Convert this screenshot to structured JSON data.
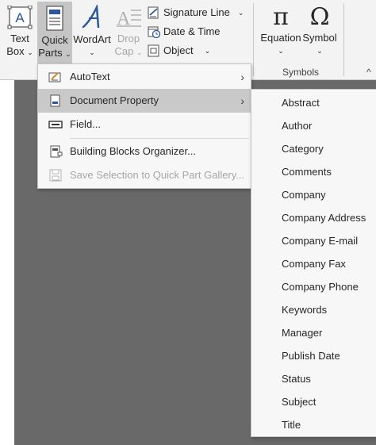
{
  "ribbon": {
    "text_box": {
      "line1": "Text",
      "line2": "Box"
    },
    "quick_parts": {
      "line1": "Quick",
      "line2": "Parts"
    },
    "wordart": {
      "line1": "WordArt"
    },
    "drop_cap": {
      "line1": "Drop",
      "line2": "Cap"
    },
    "signature_line": "Signature Line",
    "date_time": "Date & Time",
    "object": "Object",
    "equation": "Equation",
    "symbol": "Symbol",
    "symbols_group": "Symbols",
    "pi_glyph": "π",
    "omega_glyph": "Ω"
  },
  "menu": {
    "items": [
      {
        "label": "AutoText",
        "icon": "autotext-icon",
        "has_submenu": true
      },
      {
        "label": "Document Property",
        "icon": "document-property-icon",
        "has_submenu": true
      },
      {
        "label": "Field...",
        "icon": "field-icon",
        "has_submenu": false
      },
      {
        "label": "Building Blocks Organizer...",
        "icon": "building-blocks-icon",
        "has_submenu": false
      },
      {
        "label": "Save Selection to Quick Part Gallery...",
        "icon": "save-icon",
        "disabled": true
      }
    ]
  },
  "submenu": {
    "items": [
      "Abstract",
      "Author",
      "Category",
      "Comments",
      "Company",
      "Company Address",
      "Company E-mail",
      "Company Fax",
      "Company Phone",
      "Keywords",
      "Manager",
      "Publish Date",
      "Status",
      "Subject",
      "Title"
    ]
  },
  "colors": {
    "accent": "#2b579a",
    "ribbon_bg": "#f3f3f3",
    "highlight": "#c9c9c9",
    "document_bg": "#696969"
  }
}
